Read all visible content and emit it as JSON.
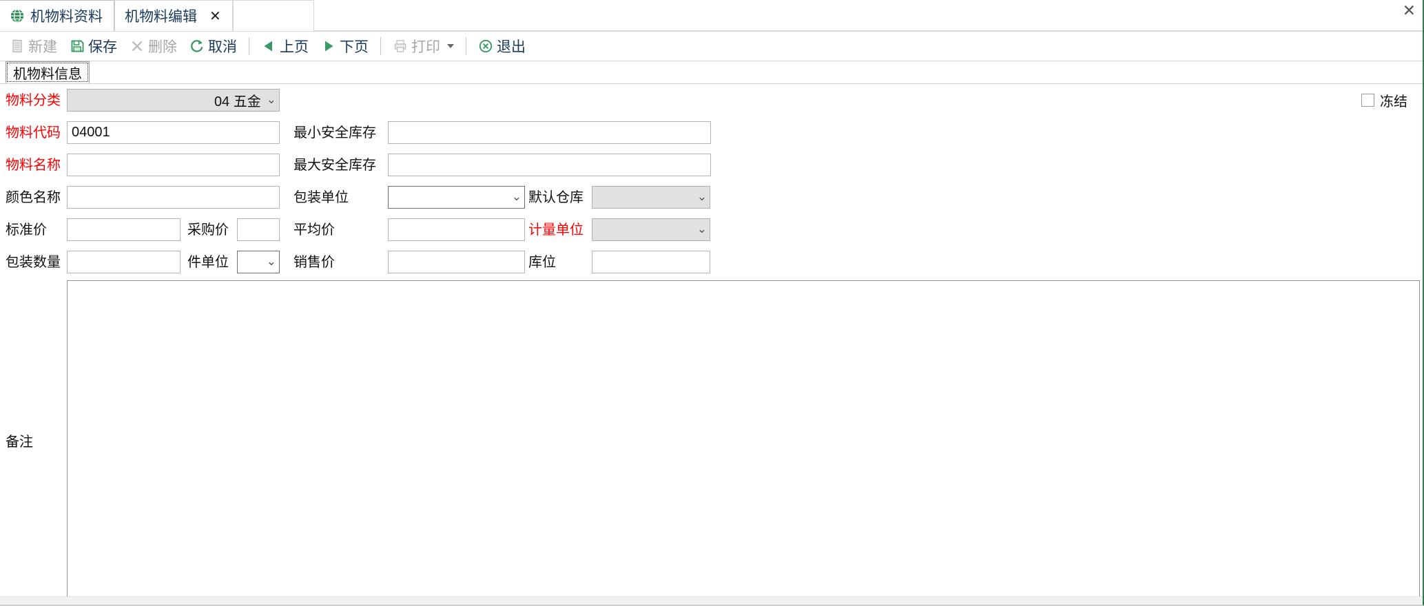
{
  "window": {
    "close_label": "✕"
  },
  "tabs": [
    {
      "label": "机物料资料",
      "icon": "globe-icon",
      "closable": false,
      "active": true
    },
    {
      "label": "机物料编辑",
      "icon": "",
      "closable": true,
      "close_label": "✕",
      "active": false
    }
  ],
  "toolbar": {
    "items": [
      {
        "label": "新建",
        "icon": "new-document-icon",
        "enabled": false
      },
      {
        "label": "保存",
        "icon": "save-floppy-icon",
        "enabled": true
      },
      {
        "label": "删除",
        "icon": "delete-cross-icon",
        "enabled": false
      },
      {
        "label": "取消",
        "icon": "refresh-cancel-icon",
        "enabled": true
      },
      {
        "label": "上页",
        "icon": "prev-triangle-icon",
        "enabled": true
      },
      {
        "label": "下页",
        "icon": "next-triangle-icon",
        "enabled": true
      },
      {
        "label": "打印",
        "icon": "printer-icon",
        "enabled": false,
        "has_dropdown": true
      },
      {
        "label": "退出",
        "icon": "exit-circle-icon",
        "enabled": true
      }
    ]
  },
  "inner_tab": {
    "label": "机物料信息"
  },
  "form": {
    "freeze": {
      "label": "冻结",
      "checked": false
    },
    "material_category": {
      "label": "物料分类",
      "required": true,
      "value": "04 五金",
      "type": "select",
      "disabled": true
    },
    "material_code": {
      "label": "物料代码",
      "required": true,
      "value": "04001",
      "type": "text"
    },
    "min_safety_stock": {
      "label": "最小安全库存",
      "required": false,
      "value": "",
      "type": "text"
    },
    "material_name": {
      "label": "物料名称",
      "required": true,
      "value": "",
      "type": "text"
    },
    "max_safety_stock": {
      "label": "最大安全库存",
      "required": false,
      "value": "",
      "type": "text"
    },
    "color_name": {
      "label": "颜色名称",
      "required": false,
      "value": "",
      "type": "text"
    },
    "packing_unit": {
      "label": "包装单位",
      "required": false,
      "value": "",
      "type": "select"
    },
    "default_warehouse": {
      "label": "默认仓库",
      "required": false,
      "value": "",
      "type": "select",
      "disabled": true
    },
    "standard_price": {
      "label": "标准价",
      "required": false,
      "value": "",
      "type": "text"
    },
    "purchase_price": {
      "label": "采购价",
      "required": false,
      "value": "",
      "type": "text"
    },
    "average_price": {
      "label": "平均价",
      "required": false,
      "value": "",
      "type": "text"
    },
    "measure_unit": {
      "label": "计量单位",
      "required": true,
      "value": "",
      "type": "select",
      "disabled": true
    },
    "packing_qty": {
      "label": "包装数量",
      "required": false,
      "value": "",
      "type": "text"
    },
    "piece_unit": {
      "label": "件单位",
      "required": false,
      "value": "",
      "type": "select"
    },
    "sales_price": {
      "label": "销售价",
      "required": false,
      "value": "",
      "type": "text"
    },
    "stock_location": {
      "label": "库位",
      "required": false,
      "value": "",
      "type": "text"
    },
    "remarks": {
      "label": "备注",
      "value": "",
      "type": "textarea"
    }
  },
  "colors": {
    "required_label": "#ff0000",
    "tab_text": "#1b3a5c",
    "accent_green": "#2e7d4f",
    "disabled_field_bg": "#e1e1e1",
    "toolbar_disabled_text": "#a8a8a8"
  }
}
